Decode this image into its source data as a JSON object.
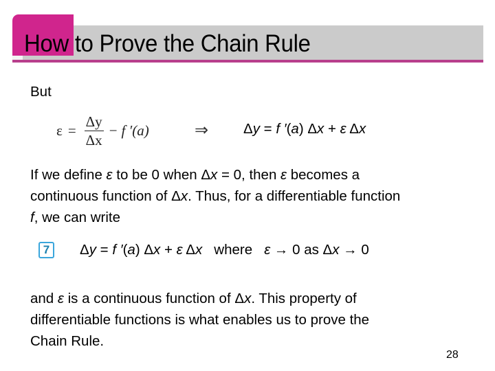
{
  "slide": {
    "title": "How to Prove the Chain Rule",
    "colors": {
      "accent_pink": "#d0258d",
      "title_bar_grey": "#cbcbcb",
      "underline": "#b83f8c",
      "equation_badge": "#3aa6dc"
    },
    "intro_word": "But",
    "formula_left": {
      "lhs": "ε",
      "equals": "=",
      "numerator": "Δy",
      "denominator": "Δx",
      "minus": "−",
      "term": "f ′(a)"
    },
    "implies_symbol": "⇒",
    "formula_right": {
      "parts": [
        "Δ",
        "y",
        " = ",
        "f ′",
        "(",
        "a",
        ") Δ",
        "x",
        " + ",
        "ε",
        " Δ",
        "x"
      ]
    },
    "paragraph1": {
      "lines": [
        [
          "If we define ",
          "ε",
          " to be 0 when Δ",
          "x",
          " = 0, then ",
          "ε",
          " becomes a"
        ],
        [
          "continuous function of Δ",
          "x",
          ". Thus, for a differentiable function"
        ],
        [
          "f",
          ", we can write"
        ]
      ]
    },
    "equation7": {
      "number": "7",
      "parts": [
        "Δ",
        "y",
        " = ",
        "f ′",
        "(",
        "a",
        ") Δ",
        "x",
        " + ",
        "ε",
        " Δ",
        "x",
        "   where   ",
        "ε",
        " → 0 as Δ",
        "x",
        " → 0"
      ]
    },
    "paragraph2": {
      "lines": [
        [
          "and ",
          "ε",
          " is a continuous function of Δ",
          "x",
          ". This property of"
        ],
        [
          "differentiable functions is what enables us to prove the"
        ],
        [
          "Chain Rule."
        ]
      ]
    },
    "page_number": "28"
  }
}
